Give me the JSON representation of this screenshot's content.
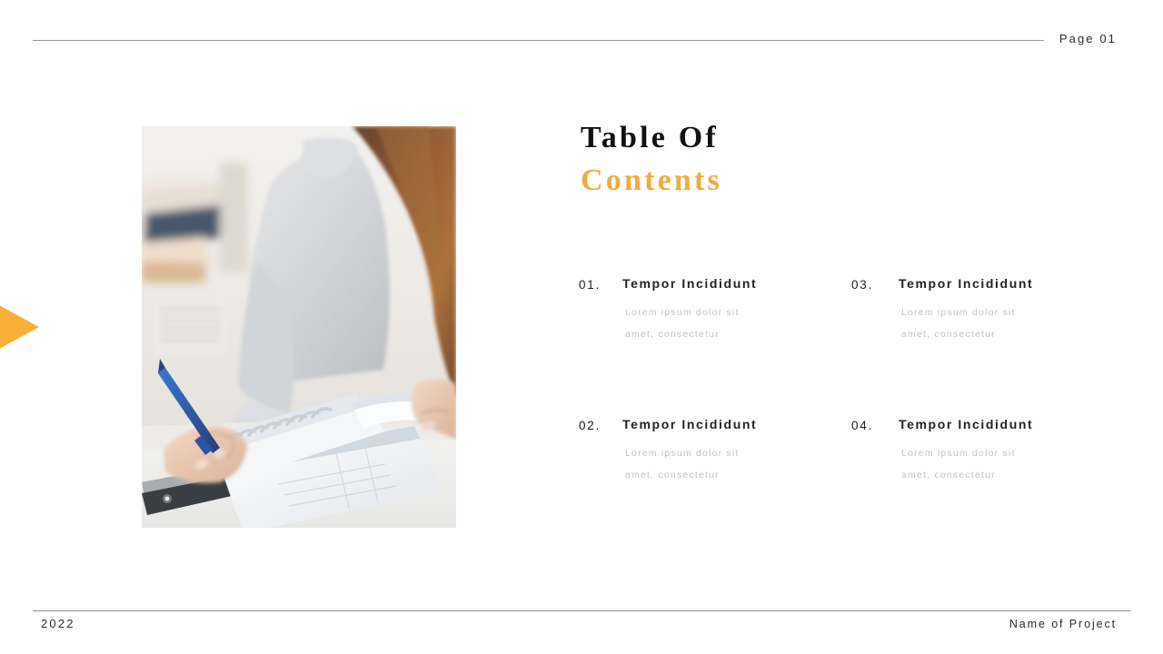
{
  "header": {
    "page_label": "Page 01",
    "rule": "header-divider"
  },
  "footer": {
    "year": "2022",
    "project_name": "Name of Project"
  },
  "title": {
    "line1": "Table Of",
    "line2": "Contents"
  },
  "photo": {
    "alt": "woman-writing-in-notebook-photo"
  },
  "colors": {
    "accent": "#F0AD3C",
    "triangle": "#F8B037",
    "heading": "#232323",
    "body": "#c3c3c3"
  },
  "contents": [
    {
      "number": "01.",
      "heading": "Tempor Incididunt",
      "desc_line1": "Lorem  ipsum  dolor  sit",
      "desc_line2": "amet,  consectetur"
    },
    {
      "number": "03.",
      "heading": "Tempor Incididunt",
      "desc_line1": "Lorem  ipsum  dolor  sit",
      "desc_line2": "amet,  consectetur"
    },
    {
      "number": "02.",
      "heading": "Tempor Incididunt",
      "desc_line1": "Lorem  ipsum  dolor  sit",
      "desc_line2": "amet,  consectetur"
    },
    {
      "number": "04.",
      "heading": "Tempor Incididunt",
      "desc_line1": "Lorem  ipsum  dolor  sit",
      "desc_line2": "amet,  consectetur"
    }
  ]
}
